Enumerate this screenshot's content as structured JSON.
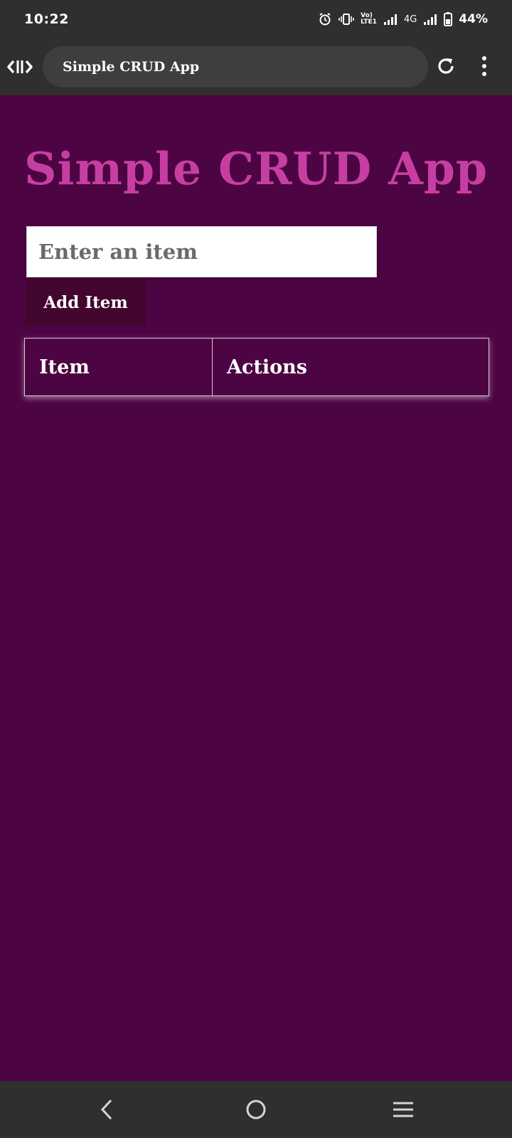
{
  "status_bar": {
    "time": "10:22",
    "volte_label": "Vo)",
    "lte_label": "LTE1",
    "network_type": "4G",
    "battery_percent": "44%"
  },
  "browser": {
    "page_title": "Simple CRUD App"
  },
  "app": {
    "title": "Simple CRUD App",
    "input": {
      "placeholder": "Enter an item",
      "value": ""
    },
    "add_button_label": "Add Item",
    "table": {
      "headers": [
        "Item",
        "Actions"
      ],
      "rows": []
    }
  },
  "colors": {
    "background": "#4d0443",
    "title": "#c73ea2",
    "button": "#42062f",
    "chrome": "#2f2f2f"
  },
  "icons": {
    "browser_logo": "code-brackets-icon",
    "reload": "reload-icon",
    "menu": "kebab-menu-icon",
    "nav_back": "back-icon",
    "nav_home": "home-icon",
    "nav_recents": "recents-icon"
  }
}
